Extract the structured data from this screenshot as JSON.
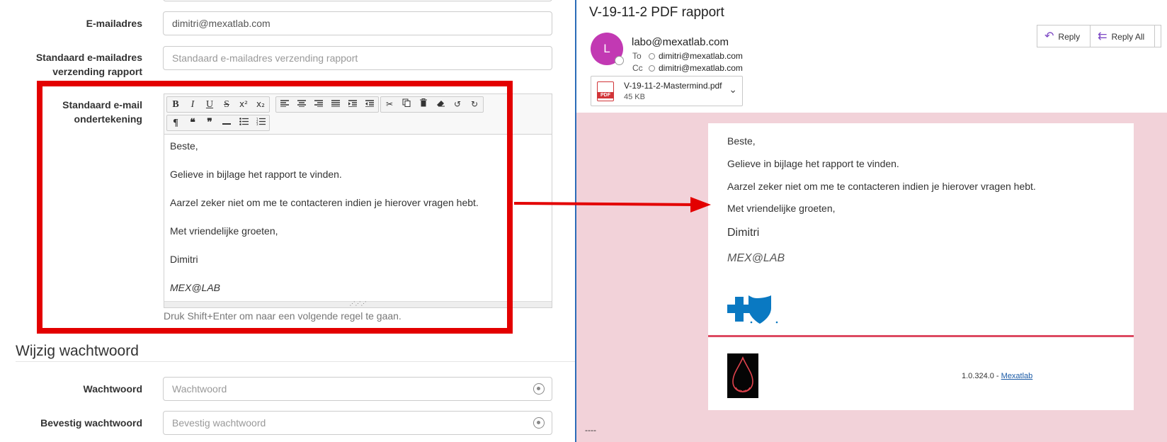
{
  "form": {
    "email_label": "E-mailadres",
    "email_value": "dimitri@mexatlab.com",
    "report_email_label_1": "Standaard e-mailadres",
    "report_email_label_2": "verzending rapport",
    "report_email_placeholder": "Standaard e-mailadres verzending rapport",
    "signature_label_1": "Standaard e-mail",
    "signature_label_2": "ondertekening",
    "editor_lines": [
      "Beste,",
      "Gelieve in bijlage het rapport te vinden.",
      "Aarzel zeker niet om me te contacteren indien je hierover vragen hebt.",
      "Met vriendelijke groeten,",
      "Dimitri",
      "MEX@LAB"
    ],
    "editor_hint": "Druk Shift+Enter om naar een volgende regel te gaan.",
    "section_title": "Wijzig wachtwoord",
    "password_label": "Wachtwoord",
    "password_placeholder": "Wachtwoord",
    "confirm_label": "Bevestig wachtwoord",
    "confirm_placeholder": "Bevestig wachtwoord"
  },
  "toolbar": {
    "row1": [
      "B",
      "I",
      "U",
      "S",
      "x²",
      "x₂",
      "align-left",
      "align-center",
      "align-right",
      "justify",
      "indent",
      "outdent",
      "cut",
      "copy",
      "delete",
      "eraser",
      "undo",
      "redo"
    ],
    "row2": [
      "¶",
      "quote-open",
      "quote-close",
      "horizontal-rule",
      "bulleted-list",
      "numbered-list"
    ]
  },
  "mail": {
    "subject": "V-19-11-2 PDF rapport",
    "avatar_letter": "L",
    "sender": "labo@mexatlab.com",
    "to_label": "To",
    "to_value": "dimitri@mexatlab.com",
    "cc_label": "Cc",
    "cc_value": "dimitri@mexatlab.com",
    "reply_label": "Reply",
    "reply_all_label": "Reply All",
    "attachment_name": "V-19-11-2-Mastermind.pdf",
    "attachment_size": "45 KB",
    "pdf_badge": "PDF",
    "body_lines": [
      "Beste,",
      "Gelieve in bijlage het rapport te vinden.",
      "Aarzel zeker niet om me te contacteren indien je hierover vragen hebt.",
      "Met vriendelijke groeten,"
    ],
    "signature_name": "Dimitri",
    "signature_company": "MEX@LAB",
    "version_text": "1.0.324.0 - ",
    "version_link": "Mexatlab",
    "dashes": "----"
  },
  "colors": {
    "highlight_red": "#e30000",
    "avatar": "#c239b3",
    "mail_background": "#f2d2d9",
    "divider": "#dd4a62",
    "logo_blue": "#0a79c2",
    "reply_icon": "#7c47c4"
  }
}
